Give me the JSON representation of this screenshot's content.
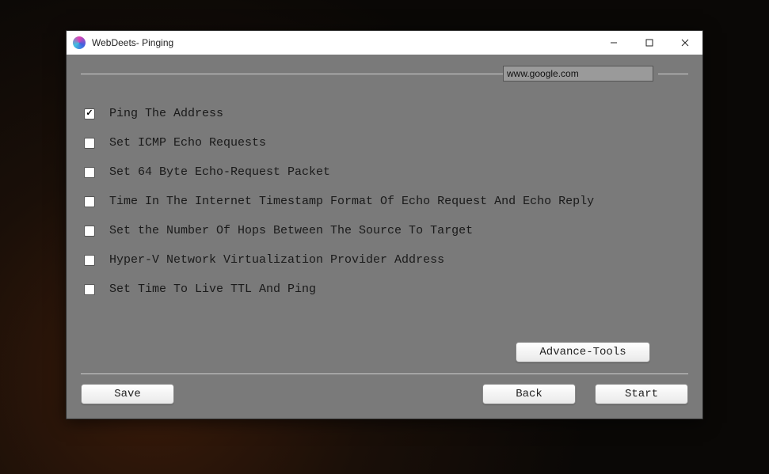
{
  "window": {
    "title": "WebDeets- Pinging"
  },
  "address": {
    "value": "www.google.com"
  },
  "options": [
    {
      "label": "Ping The Address",
      "checked": true
    },
    {
      "label": "Set ICMP Echo Requests",
      "checked": false
    },
    {
      "label": "Set 64 Byte Echo-Request Packet",
      "checked": false
    },
    {
      "label": "Time In The Internet Timestamp Format Of Echo Request And Echo Reply",
      "checked": false
    },
    {
      "label": "Set the Number Of Hops Between The Source To Target",
      "checked": false
    },
    {
      "label": "Hyper-V Network Virtualization Provider Address",
      "checked": false
    },
    {
      "label": "Set Time To Live TTL And Ping",
      "checked": false
    }
  ],
  "buttons": {
    "advance": "Advance-Tools",
    "save": "Save",
    "back": "Back",
    "start": "Start"
  }
}
